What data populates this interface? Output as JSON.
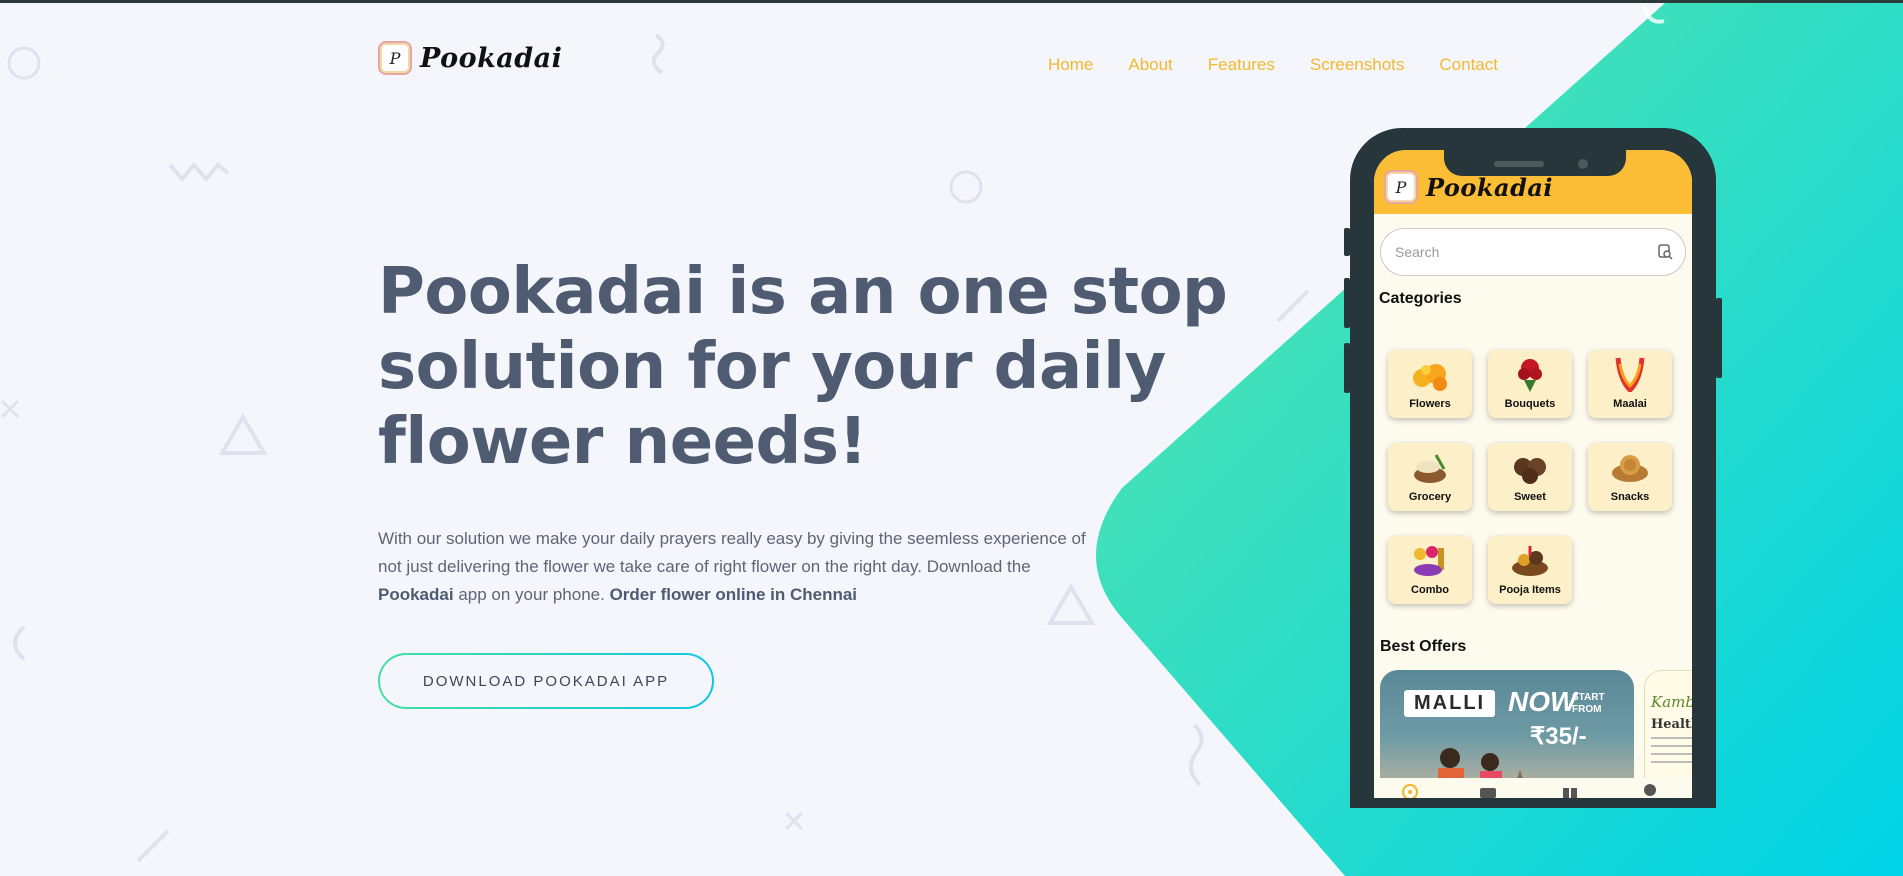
{
  "brand": {
    "name": "Pookadai",
    "logo_letter": "P"
  },
  "nav": {
    "items": [
      "Home",
      "About",
      "Features",
      "Screenshots",
      "Contact"
    ]
  },
  "hero": {
    "title": "Pookadai is an one stop solution for your daily flower needs!",
    "desc_part1": "With our solution we make your daily prayers really easy by giving the seemless experience of not just delivering the flower we take care of right flower on the right day. Download the ",
    "desc_bold1": "Pookadai",
    "desc_part2": " app on your phone. ",
    "desc_bold2": "Order flower online in Chennai",
    "cta": "DOWNLOAD POOKADAI APP"
  },
  "app": {
    "title": "Pookadai",
    "search_placeholder": "Search",
    "categories_title": "Categories",
    "categories": [
      "Flowers",
      "Bouquets",
      "Maalai",
      "Grocery",
      "Sweet",
      "Snacks",
      "Combo",
      "Pooja Items"
    ],
    "offers_title": "Best Offers",
    "offer": {
      "brand": "MALLI",
      "now": "NOW",
      "start": "START",
      "from": "FROM",
      "price": "₹35/-"
    },
    "offer2": {
      "brand": "Kamb",
      "heading": "Health"
    }
  },
  "colors": {
    "accent": "#f5b82e",
    "title": "#4f5b70",
    "gradient_start": "#55e3a8",
    "gradient_end": "#00d4e8"
  },
  "icons": [
    "search-icon",
    "home-icon",
    "wallet-icon",
    "gift-icon",
    "profile-icon"
  ]
}
